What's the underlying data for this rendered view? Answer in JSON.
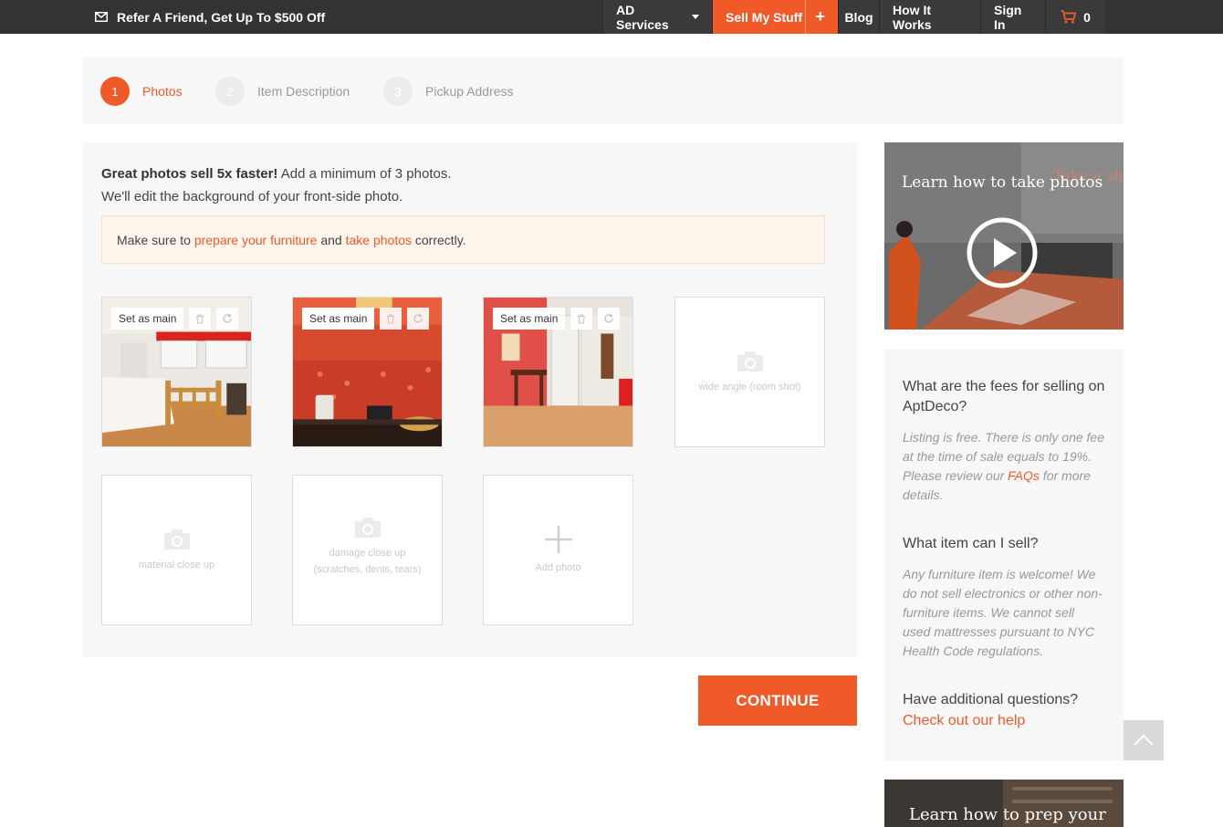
{
  "topbar": {
    "refer_text": "Refer A Friend, Get Up To $500 Off",
    "nav": {
      "ad_services": "AD Services",
      "sell_my_stuff": "Sell My Stuff",
      "sell_plus": "+",
      "blog": "Blog",
      "how_it_works": "How It Works",
      "sign_in": "Sign In",
      "cart_count": "0"
    }
  },
  "steps": [
    {
      "num": "1",
      "label": "Photos"
    },
    {
      "num": "2",
      "label": "Item Description"
    },
    {
      "num": "3",
      "label": "Pickup Address"
    }
  ],
  "intro": {
    "bold": "Great photos sell 5x faster!",
    "line1_rest": " Add a minimum of 3 photos.",
    "line2": "We'll edit the background of your front-side photo."
  },
  "notice": {
    "prefix": "Make sure to ",
    "link1": "prepare your furniture",
    "middle": " and ",
    "link2": "take photos",
    "suffix": " correctly."
  },
  "photo_tiles": [
    {
      "set_main": "Set as main"
    },
    {
      "set_main": "Set as main"
    },
    {
      "set_main": "Set as main"
    }
  ],
  "empty_tiles": {
    "wide_angle": "wide angle (room shot)",
    "material": "material close up",
    "damage_line1": "damage close up",
    "damage_line2": "(scratches, dents, tears)",
    "add_photo": "Add photo"
  },
  "continue_label": "CONTINUE",
  "video1": {
    "title": "Learn how to take photos",
    "overlay": "Take a sh from eye-lev"
  },
  "faq": {
    "q1": "What are the fees for selling on AptDeco?",
    "a1_pre": "Listing is free. There is only one fee at the time of sale equals to 19%. Please review our ",
    "a1_link": "FAQs",
    "a1_post": " for more details.",
    "q2": "What item can I sell?",
    "a2": "Any furniture item is welcome! We do not sell electronics or other non-furniture items. We cannot sell used mattresses pursuant to NYC Health Code regulations.",
    "q3": "Have additional questions?",
    "help_link": "Check out our help"
  },
  "video2": {
    "title": "Learn how to prep your"
  },
  "colors": {
    "accent": "#f05a28",
    "topbar": "#333333",
    "panel": "#f7f7f7"
  }
}
